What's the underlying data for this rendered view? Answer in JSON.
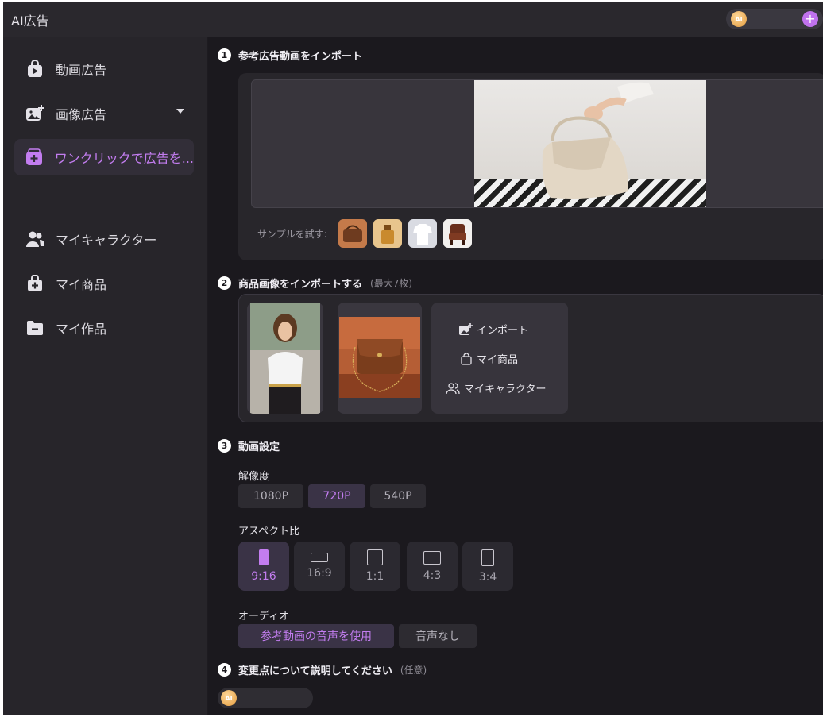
{
  "app": {
    "title": "AI広告"
  },
  "header": {
    "plus_label": "+",
    "coin_label": "AI"
  },
  "sidebar": {
    "items": [
      {
        "label": "動画広告",
        "icon": "video-bag-icon"
      },
      {
        "label": "画像広告",
        "icon": "image-add-icon",
        "has_dropdown": true
      },
      {
        "label": "ワンクリックで広告を...",
        "icon": "one-click-icon",
        "active": true
      },
      {
        "label": "マイキャラクター",
        "icon": "people-icon"
      },
      {
        "label": "マイ商品",
        "icon": "bag-add-icon"
      },
      {
        "label": "マイ作品",
        "icon": "folder-icon"
      }
    ]
  },
  "sections": {
    "s1": {
      "num": "1",
      "title": "参考広告動画をインポート",
      "sample_label": "サンプルを試す:"
    },
    "s2": {
      "num": "2",
      "title": "商品画像をインポートする",
      "hint": "(最大7枚)",
      "import_options": [
        "インポート",
        "マイ商品",
        "マイキャラクター"
      ]
    },
    "s3": {
      "num": "3",
      "title": "動画設定",
      "resolution_label": "解像度",
      "resolutions": [
        "1080P",
        "720P",
        "540P"
      ],
      "resolution_selected": "720P",
      "aspect_label": "アスペクト比",
      "aspects": [
        "9:16",
        "16:9",
        "1:1",
        "4:3",
        "3:4"
      ],
      "aspect_selected": "9:16",
      "audio_label": "オーディオ",
      "audio_options": [
        "参考動画の音声を使用",
        "音声なし"
      ],
      "audio_selected": "参考動画の音声を使用"
    },
    "s4": {
      "num": "4",
      "title": "変更点について説明してください",
      "hint": "(任意)"
    }
  },
  "colors": {
    "accent": "#c37df0",
    "background": "#1b191e",
    "sidebar": "#27252a"
  }
}
